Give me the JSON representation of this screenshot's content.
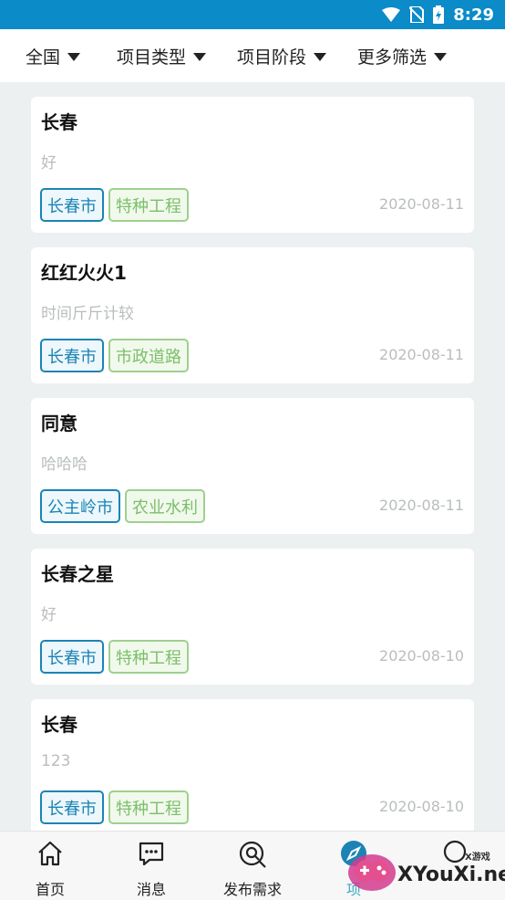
{
  "status_bar": {
    "time": "8:29",
    "icons": [
      "wifi-icon",
      "no-sim-icon",
      "battery-charging-icon"
    ]
  },
  "filters": [
    {
      "label": "全国"
    },
    {
      "label": "项目类型"
    },
    {
      "label": "项目阶段"
    },
    {
      "label": "更多筛选"
    }
  ],
  "projects": [
    {
      "title": "长春",
      "desc": "好",
      "city": "长春市",
      "type": "特种工程",
      "date": "2020-08-11"
    },
    {
      "title": "红红火火1",
      "desc": "时间斤斤计较",
      "city": "长春市",
      "type": "市政道路",
      "date": "2020-08-11"
    },
    {
      "title": "同意",
      "desc": "哈哈哈",
      "city": "公主岭市",
      "type": "农业水利",
      "date": "2020-08-11"
    },
    {
      "title": "长春之星",
      "desc": "好",
      "city": "长春市",
      "type": "特种工程",
      "date": "2020-08-10"
    },
    {
      "title": "长春",
      "desc": "123",
      "city": "长春市",
      "type": "特种工程",
      "date": "2020-08-10"
    }
  ],
  "tabs": [
    {
      "label": "首页",
      "icon": "home-icon"
    },
    {
      "label": "消息",
      "icon": "message-icon"
    },
    {
      "label": "发布需求",
      "icon": "search-publish-icon"
    },
    {
      "label": "项",
      "icon": "compass-icon"
    },
    {
      "label": "",
      "icon": "profile-icon"
    }
  ],
  "watermark": {
    "text": "XYouXi.net",
    "small": "X游戏"
  },
  "colors": {
    "status_bar": "#0b8bc7",
    "city_tag": "#1b84b4",
    "type_tag": "#7cbf6a",
    "active_tab": "#3aa8c6"
  }
}
